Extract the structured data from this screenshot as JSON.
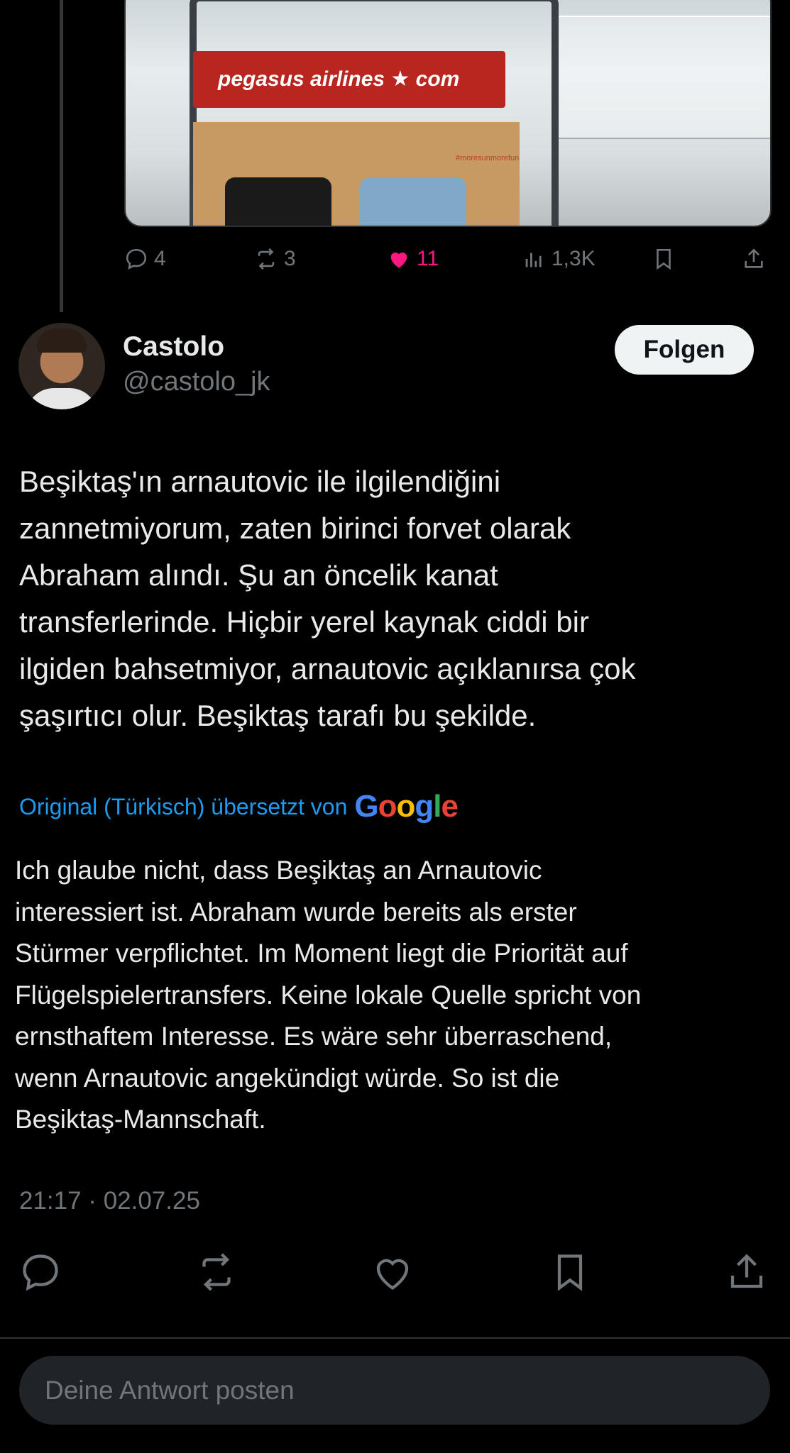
{
  "previous_tweet": {
    "media": {
      "sign_text": "pegasus airlines ★ com",
      "tag_text": "#moresunmorefun"
    },
    "actions": {
      "replies": "4",
      "reposts": "3",
      "likes": "11",
      "views": "1,3K"
    }
  },
  "tweet": {
    "author_name": "Castolo",
    "author_handle": "@castolo_jk",
    "follow_label": "Folgen",
    "text": "Beşiktaş'ın arnautovic ile ilgilendiğini\nzannetmiyorum, zaten birinci forvet olarak\nAbraham alındı. Şu an öncelik kanat\ntransferlerinde. Hiçbir yerel kaynak ciddi bir\nilgiden bahsetmiyor, arnautovic açıklanırsa çok\nşaşırtıcı olur. Beşiktaş tarafı bu şekilde.",
    "translation_note": "Original (Türkisch) übersetzt von",
    "translation_provider": "Google",
    "translated_text": "Ich glaube nicht, dass Beşiktaş an Arnautovic\ninteressiert ist. Abraham wurde bereits als erster\nStürmer verpflichtet. Im Moment liegt die Priorität auf\nFlügelspielertransfers. Keine lokale Quelle spricht von\nernsthaftem Interesse. Es wäre sehr überraschend,\nwenn Arnautovic angekündigt würde. So ist die\nBeşiktaş-Mannschaft.",
    "timestamp": "21:17 · 02.07.25"
  },
  "reply": {
    "placeholder": "Deine Antwort posten"
  },
  "icons": [
    "reply-icon",
    "repost-icon",
    "like-icon",
    "views-icon",
    "bookmark-icon",
    "share-icon"
  ],
  "colors": {
    "accent": "#1d9bf0",
    "like": "#f91880",
    "muted": "#71767b",
    "background": "#000000"
  }
}
